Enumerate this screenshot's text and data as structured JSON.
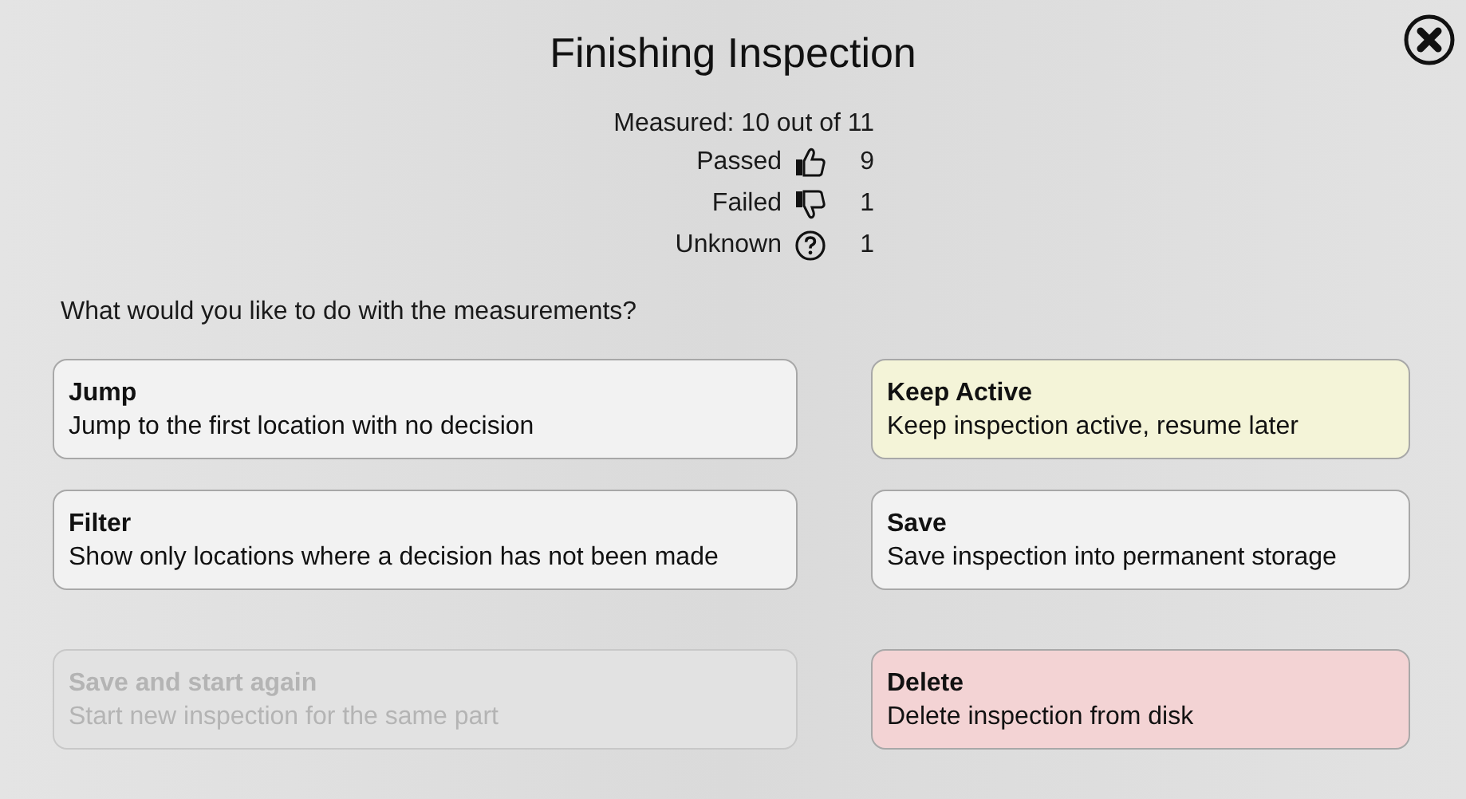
{
  "dialog": {
    "title": "Finishing Inspection"
  },
  "summary": {
    "measured": "Measured: 10 out of 11",
    "stats": [
      {
        "kind": "passed",
        "label": "Passed",
        "value": "9"
      },
      {
        "kind": "failed",
        "label": "Failed",
        "value": "1"
      },
      {
        "kind": "unknown",
        "label": "Unknown",
        "value": "1"
      }
    ]
  },
  "question": "What would you like to do with the measurements?",
  "left_actions": [
    {
      "title": "Jump",
      "description": "Jump to the first location with no decision",
      "color": "#f2f2f2",
      "disabled": false
    },
    {
      "title": "Filter",
      "description": "Show only locations where a decision has not been made",
      "color": "#f2f2f2",
      "disabled": false
    },
    {
      "title": "Save and start again",
      "description": "Start new inspection for the same part",
      "color": "#e2e2e2",
      "disabled": true
    }
  ],
  "right_actions": [
    {
      "title": "Keep Active",
      "description": "Keep inspection active, resume later",
      "color": "#f4f4d8",
      "disabled": false
    },
    {
      "title": "Save",
      "description": "Save inspection into permanent storage",
      "color": "#f2f2f2",
      "disabled": false
    },
    {
      "title": "Delete",
      "description": "Delete inspection from disk",
      "color": "#f3d3d4",
      "disabled": false
    }
  ]
}
